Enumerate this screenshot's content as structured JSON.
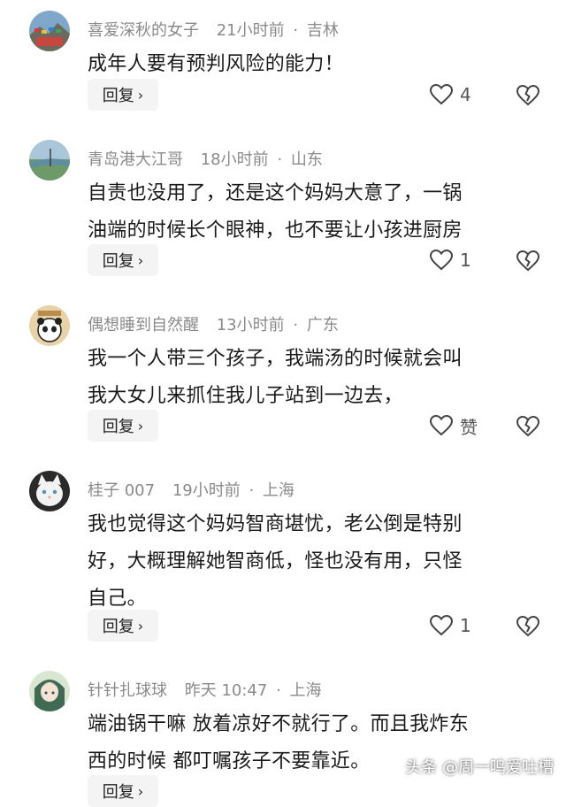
{
  "comments": [
    {
      "user": "喜爱深秋的女子",
      "time": "21小时前",
      "location": "吉林",
      "lines": [
        "成年人要有预判风险的能力！"
      ],
      "reply_label": "回复",
      "like_count": "4",
      "avatar_icon": "avatar-mountain-flags"
    },
    {
      "user": "青岛港大江哥",
      "time": "18小时前",
      "location": "山东",
      "lines": [
        "自责也没用了，还是这个妈妈大意了，一锅",
        "油端的时候长个眼神，也不要让小孩进厨房"
      ],
      "reply_label": "回复",
      "like_count": "1",
      "avatar_icon": "avatar-landscape"
    },
    {
      "user": "偶想睡到自然醒",
      "time": "13小时前",
      "location": "广东",
      "lines": [
        "我一个人带三个孩子，我端汤的时候就会叫",
        "我大女儿来抓住我儿子站到一边去，"
      ],
      "reply_label": "回复",
      "like_count": "赞",
      "avatar_icon": "avatar-panda"
    },
    {
      "user": "桂子 007",
      "time": "19小时前",
      "location": "上海",
      "lines": [
        "我也觉得这个妈妈智商堪忧，老公倒是特别",
        "好，大概理解她智商低，怪也没有用，只怪",
        "自己。"
      ],
      "reply_label": "回复",
      "like_count": "1",
      "avatar_icon": "avatar-white-cat"
    },
    {
      "user": "针针扎球球",
      "time": "昨天 10:47",
      "location": "上海",
      "lines": [
        "端油锅干嘛 放着凉好不就行了。而且我炸东",
        "西的时候 都叮嘱孩子不要靠近。"
      ],
      "reply_label": "回复",
      "like_count": "",
      "avatar_icon": "avatar-anime-girl"
    }
  ],
  "separator": "·",
  "watermark": "头条 @周一鸣爱吐槽",
  "colors": {
    "meta": "#8a8a8a",
    "text": "#1a1a1a",
    "button_bg": "#f4f4f4"
  }
}
